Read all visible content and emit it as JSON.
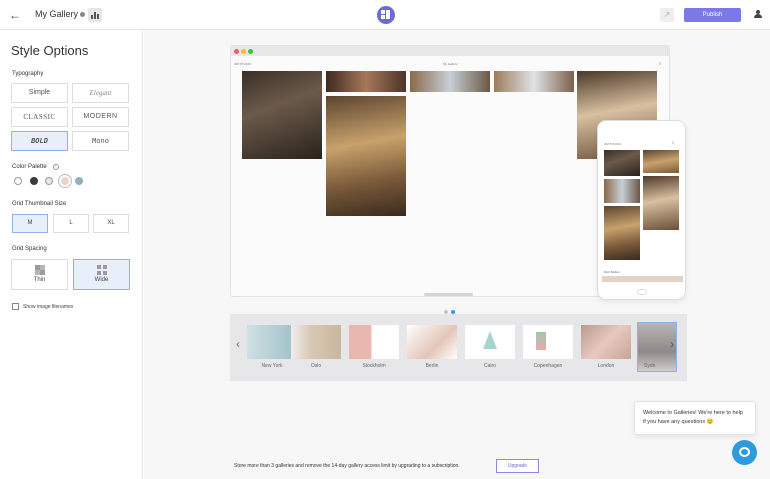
{
  "header": {
    "back_icon": "arrow-left-icon",
    "gallery_title": "My Gallery",
    "publish_label": "Publish"
  },
  "sidebar": {
    "title": "Style Options",
    "typography": {
      "label": "Typography",
      "options": [
        "Simple",
        "Elegant",
        "CLASSIC",
        "MODERN",
        "BOLD",
        "Mono"
      ],
      "selected": "BOLD"
    },
    "color_palette": {
      "label": "Color Palette",
      "swatches": [
        "#ffffff",
        "#3a3a3a",
        "#e6e6e6",
        "#e8d6c8",
        "#8fb1bf"
      ],
      "selected_index": 3
    },
    "thumbnail_size": {
      "label": "Grid Thumbnail Size",
      "options": [
        "M",
        "L",
        "XL"
      ],
      "selected": "M"
    },
    "spacing": {
      "label": "Grid Spacing",
      "options": [
        "Thin",
        "Wide"
      ],
      "selected": "Wide"
    },
    "show_filenames_label": "Show image filenames"
  },
  "preview": {
    "site_title": "My Gallery",
    "brand_left": "JIM STUDIO",
    "phone_caption": "Rich Mullan"
  },
  "templates": [
    {
      "name": "New York",
      "visible": "New York"
    },
    {
      "name": "Oslo"
    },
    {
      "name": "Stockholm"
    },
    {
      "name": "Berlin"
    },
    {
      "name": "Cairo"
    },
    {
      "name": "Copenhagen"
    },
    {
      "name": "London"
    },
    {
      "name": "Sydney",
      "visible": "Sydn"
    }
  ],
  "footer": {
    "notice": "Store more than 3 galleries and remove the 14-day gallery access limit by upgrading to a subscription.",
    "upgrade_label": "Upgrade"
  },
  "chat": {
    "message": "Welcome to Galleries! We're here to help if you have any questions 😊"
  },
  "colors": {
    "accent": "#7b78e8",
    "selected_bg": "#e8effb",
    "chat_blue": "#2f9bdc"
  }
}
